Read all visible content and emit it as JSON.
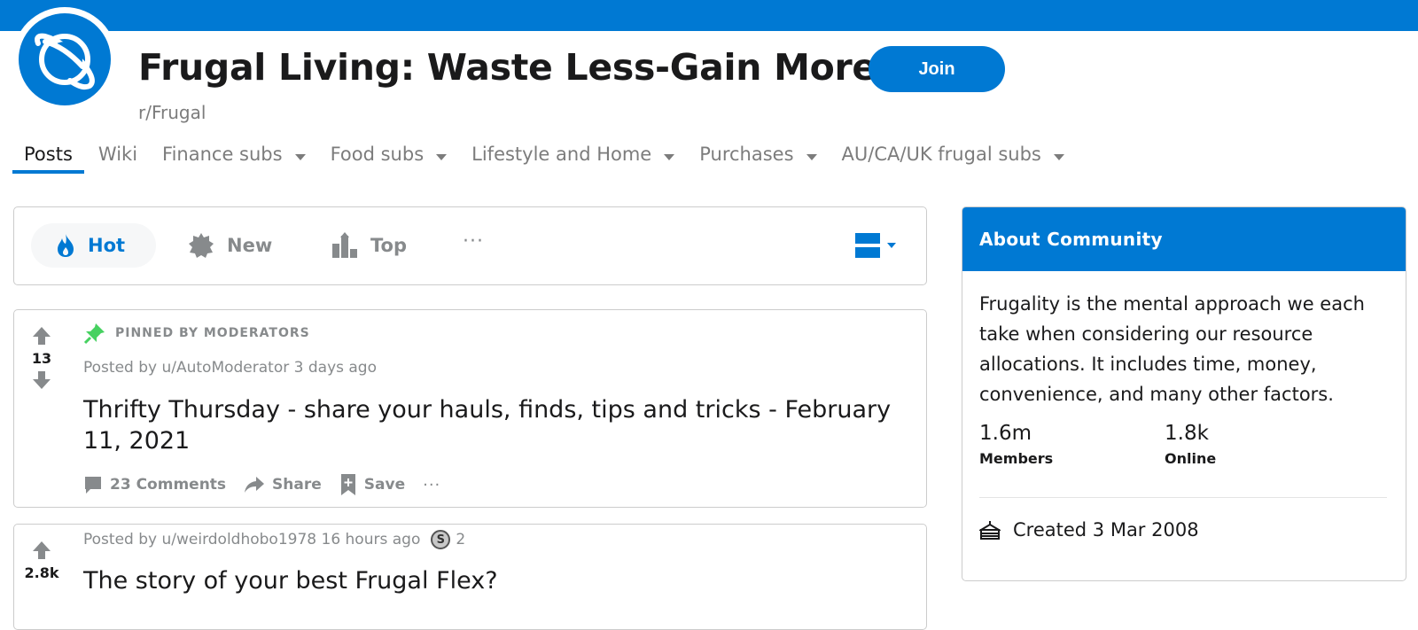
{
  "header": {
    "title": "Frugal Living: Waste Less-Gain More!",
    "subreddit": "r/Frugal",
    "join_label": "Join"
  },
  "nav": {
    "items": [
      {
        "label": "Posts"
      },
      {
        "label": "Wiki"
      },
      {
        "label": "Finance subs"
      },
      {
        "label": "Food subs"
      },
      {
        "label": "Lifestyle and Home"
      },
      {
        "label": "Purchases"
      },
      {
        "label": "AU/CA/UK frugal subs"
      }
    ]
  },
  "sort": {
    "hot": "Hot",
    "new": "New",
    "top": "Top",
    "more": "···"
  },
  "posts": [
    {
      "votes": "13",
      "pinned_label": "PINNED BY MODERATORS",
      "posted_by": "Posted by u/AutoModerator 3 days ago",
      "title": "Thrifty Thursday - share your hauls, finds, tips and tricks - February 11, 2021",
      "comments": "23 Comments",
      "share": "Share",
      "save": "Save",
      "more": "···"
    },
    {
      "votes": "2.8k",
      "posted_by": "Posted by u/weirdoldhobo1978 16 hours ago",
      "award_symbol": "S",
      "award_count": "2",
      "title": "The story of your best Frugal Flex?"
    }
  ],
  "about": {
    "header": "About Community",
    "description": "Frugality is the mental approach we each take when considering our resource allocations. It includes time, money, convenience, and many other factors.",
    "members_value": "1.6m",
    "members_label": "Members",
    "online_value": "1.8k",
    "online_label": "Online",
    "created": "Created 3 Mar 2008"
  },
  "colors": {
    "accent": "#0079d3",
    "muted_text": "#878a8c",
    "pin_green": "#46d160"
  }
}
